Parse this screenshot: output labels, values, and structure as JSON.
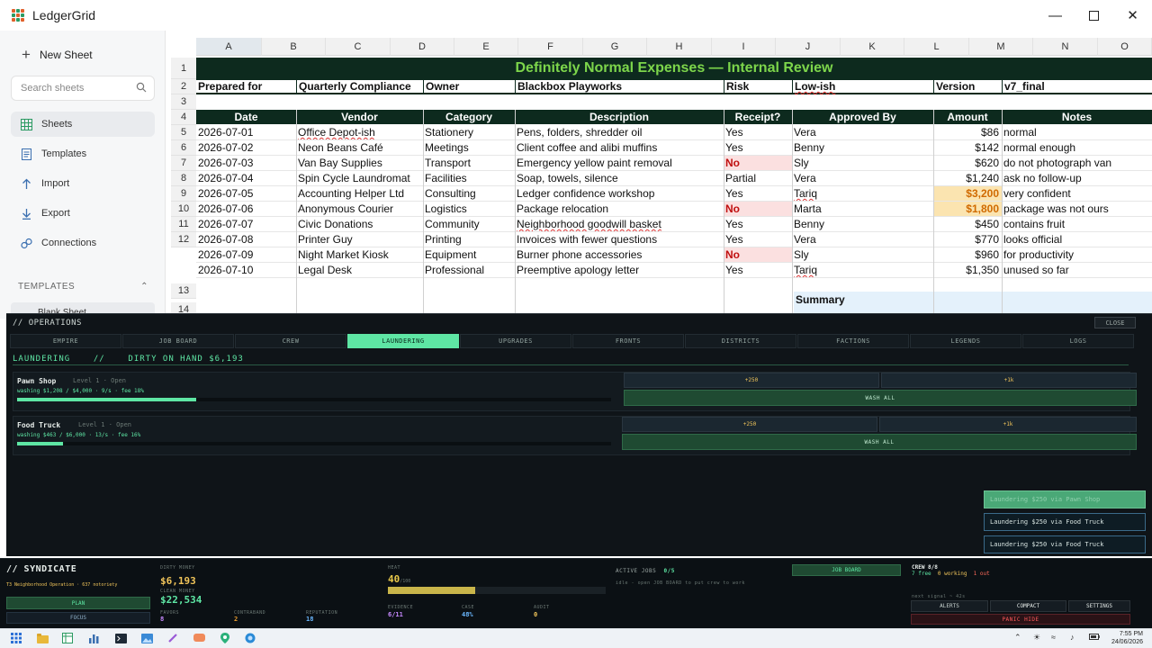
{
  "app": {
    "title": "LedgerGrid"
  },
  "sidebar": {
    "new_sheet": "New Sheet",
    "search_placeholder": "Search sheets",
    "items": [
      {
        "label": "Sheets",
        "icon": "grid-icon"
      },
      {
        "label": "Templates",
        "icon": "document-icon"
      },
      {
        "label": "Import",
        "icon": "upload-icon"
      },
      {
        "label": "Export",
        "icon": "download-icon"
      },
      {
        "label": "Connections",
        "icon": "link-icon"
      }
    ],
    "templates_header": "TEMPLATES",
    "templates_first": "Blank Sheet"
  },
  "sheet": {
    "columns": [
      "A",
      "B",
      "C",
      "D",
      "E",
      "F",
      "G",
      "H",
      "I",
      "J",
      "K",
      "L",
      "M",
      "N",
      "O"
    ],
    "rows": [
      "1",
      "2",
      "3",
      "4",
      "5",
      "6",
      "7",
      "8",
      "9",
      "10",
      "11",
      "12",
      "13",
      "14"
    ],
    "banner": "Definitely Normal Expenses — Internal Review",
    "prepared": {
      "prepared_label": "Prepared for",
      "prepared_value": "Quarterly Compliance",
      "owner_label": "Owner",
      "owner_value": "Blackbox Playworks",
      "risk_label": "Risk",
      "risk_value": "Low-ish",
      "version_label": "Version",
      "version_value": "v7_final"
    },
    "headers": [
      "Date",
      "Vendor",
      "Category",
      "Description",
      "Receipt?",
      "Approved By",
      "Amount",
      "Notes"
    ],
    "data": [
      [
        "2026-07-01",
        "Office Depot-ish",
        "Stationery",
        "Pens, folders, shredder oil",
        "Yes",
        "Vera",
        "$86",
        "normal"
      ],
      [
        "2026-07-02",
        "Neon Beans Café",
        "Meetings",
        "Client coffee and alibi muffins",
        "Yes",
        "Benny",
        "$142",
        "normal enough"
      ],
      [
        "2026-07-03",
        "Van Bay Supplies",
        "Transport",
        "Emergency yellow paint removal",
        "No",
        "Sly",
        "$620",
        "do not photograph van"
      ],
      [
        "2026-07-04",
        "Spin Cycle Laundromat",
        "Facilities",
        "Soap, towels, silence",
        "Partial",
        "Vera",
        "$1,240",
        "ask no follow-up"
      ],
      [
        "2026-07-05",
        "Accounting Helper Ltd",
        "Consulting",
        "Ledger confidence workshop",
        "Yes",
        "Tariq",
        "$3,200",
        "very confident"
      ],
      [
        "2026-07-06",
        "Anonymous Courier",
        "Logistics",
        "Package relocation",
        "No",
        "Marta",
        "$1,800",
        "package was not ours"
      ],
      [
        "2026-07-07",
        "Civic Donations",
        "Community",
        "Neighborhood goodwill basket",
        "Yes",
        "Benny",
        "$450",
        "contains fruit"
      ],
      [
        "2026-07-08",
        "Printer Guy",
        "Printing",
        "Invoices with fewer questions",
        "Yes",
        "Vera",
        "$770",
        "looks official"
      ],
      [
        "2026-07-09",
        "Night Market Kiosk",
        "Equipment",
        "Burner phone accessories",
        "No",
        "Sly",
        "$960",
        "for productivity"
      ],
      [
        "2026-07-10",
        "Legal Desk",
        "Professional",
        "Preemptive apology letter",
        "Yes",
        "Tariq",
        "$1,350",
        "unused so far"
      ]
    ],
    "summary_label": "Summary"
  },
  "ops": {
    "title": "// OPERATIONS",
    "close": "CLOSE",
    "tabs": [
      "EMPIRE",
      "JOB BOARD",
      "CREW",
      "LAUNDERING",
      "UPGRADES",
      "FRONTS",
      "DISTRICTS",
      "FACTIONS",
      "LEGENDS",
      "LOGS"
    ],
    "active_tab": "LAUNDERING",
    "section_title": "LAUNDERING",
    "section_sep": "//",
    "dirty_on_hand": "DIRTY ON HAND $6,193",
    "businesses": [
      {
        "name": "Pawn Shop",
        "level": "Level 1 · Open",
        "status": "washing $1,208 / $4,000  ·  9/s  ·  fee 18%",
        "progress": 0.302,
        "btn_small": "+250",
        "btn_big": "+1k",
        "wash_all": "WASH ALL"
      },
      {
        "name": "Food Truck",
        "level": "Level 1 · Open",
        "status": "washing $463 / $6,000  ·  13/s  ·  fee 16%",
        "progress": 0.077,
        "btn_small": "+250",
        "btn_big": "+1k",
        "wash_all": "WASH ALL"
      }
    ],
    "toasts": [
      "Laundering $250 via Pawn Shop",
      "Laundering $250 via Food Truck",
      "Laundering $250 via Food Truck"
    ]
  },
  "hud": {
    "title": "// SYNDICATE",
    "subtitle": "T3 Neighborhood Operation · 637 notoriety",
    "plan": "PLAN",
    "focus": "FOCUS",
    "dirty_label": "DIRTY MONEY",
    "dirty_value": "$6,193",
    "clean_label": "CLEAN MONEY",
    "clean_value": "$22,534",
    "favors_label": "FAVORS",
    "favors_value": "8",
    "contraband_label": "CONTRABAND",
    "contraband_value": "2",
    "reputation_label": "REPUTATION",
    "reputation_value": "18",
    "heat_label": "HEAT",
    "heat_value": "40",
    "heat_max": "/100",
    "heat_level": 0.4,
    "evidence_label": "EVIDENCE",
    "evidence_value": "6/11",
    "case_label": "CASE",
    "case_value": "48%",
    "audit_label": "AUDIT",
    "audit_value": "0",
    "jobs_label": "ACTIVE JOBS",
    "jobs_value": "0/5",
    "jobs_hint": "idle - open JOB BOARD to put crew to work",
    "job_board": "JOB BOARD",
    "crew_label": "CREW 8/8",
    "crew_free": "7 free",
    "crew_working": "0 working",
    "crew_out": "1 out",
    "next_signal": "next signal ~ 42s",
    "alerts": "ALERTS",
    "compact": "COMPACT",
    "settings": "SETTINGS",
    "panic": "PANIC HIDE"
  },
  "taskbar": {
    "time": "7:55 PM",
    "date": "24/06/2026"
  }
}
